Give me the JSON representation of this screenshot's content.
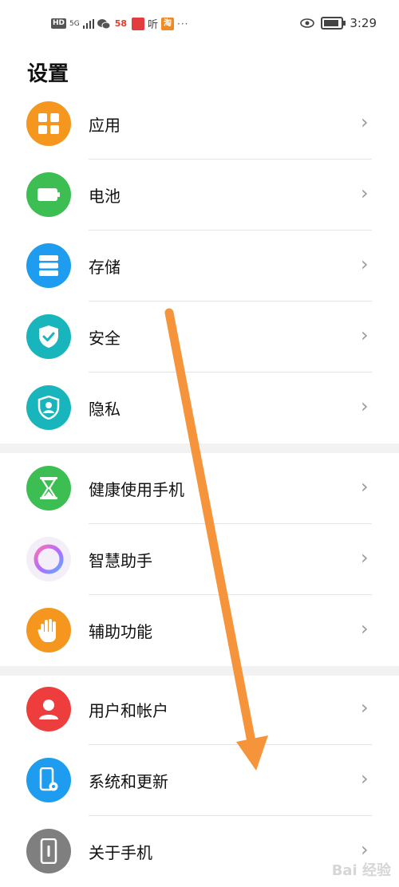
{
  "status_bar": {
    "hd": "HD",
    "signal": "5G",
    "app_58": "58",
    "listen": "听",
    "taobao": "淘",
    "more": "···",
    "time": "3:29"
  },
  "page_title": "设置",
  "groups": [
    {
      "items": [
        {
          "label": "应用",
          "icon": "grid-icon",
          "color": "#F5961E"
        },
        {
          "label": "电池",
          "icon": "battery-icon",
          "color": "#3DBE52"
        },
        {
          "label": "存储",
          "icon": "storage-icon",
          "color": "#1E9CF0"
        },
        {
          "label": "安全",
          "icon": "shield-check-icon",
          "color": "#19B5BC"
        },
        {
          "label": "隐私",
          "icon": "privacy-icon",
          "color": "#19B5BC"
        }
      ]
    },
    {
      "items": [
        {
          "label": "健康使用手机",
          "icon": "hourglass-icon",
          "color": "#3DBE52"
        },
        {
          "label": "智慧助手",
          "icon": "assistant-ring-icon",
          "color": "#F3EEF8"
        },
        {
          "label": "辅助功能",
          "icon": "hand-icon",
          "color": "#F5961E"
        }
      ]
    },
    {
      "items": [
        {
          "label": "用户和帐户",
          "icon": "user-icon",
          "color": "#EE3D3D"
        },
        {
          "label": "系统和更新",
          "icon": "phone-settings-icon",
          "color": "#1E9CF0"
        },
        {
          "label": "关于手机",
          "icon": "phone-info-icon",
          "color": "#7F7F7F"
        }
      ]
    }
  ],
  "chevron": "›",
  "watermark": "Bai 经验",
  "annotation_color": "#F5943A"
}
